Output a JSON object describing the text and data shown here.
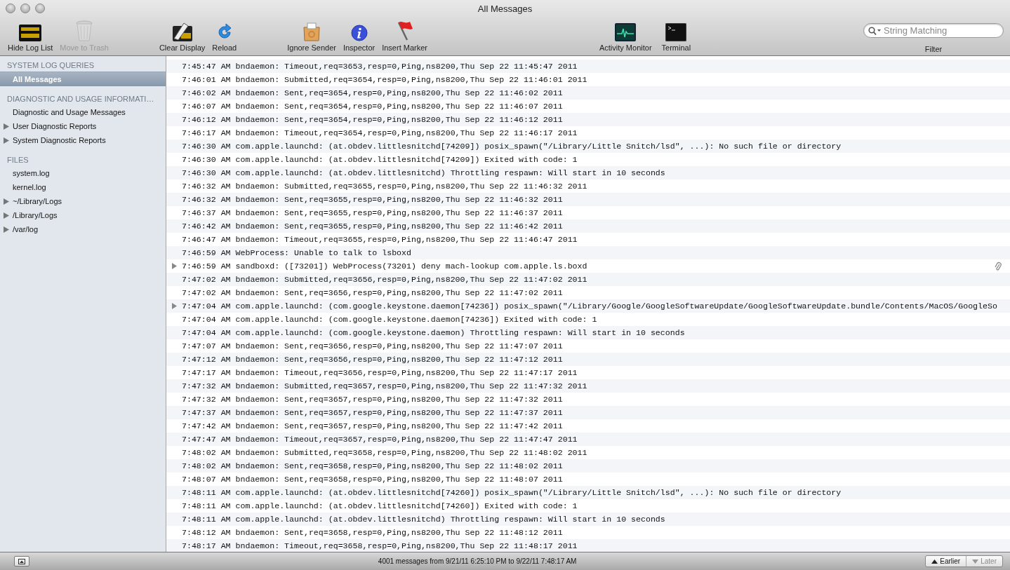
{
  "window": {
    "title": "All Messages"
  },
  "toolbar": {
    "left": [
      {
        "label": "Hide Log List",
        "disabled": false
      },
      {
        "label": "Move to Trash",
        "disabled": true
      },
      {
        "label": "Clear Display",
        "disabled": false
      },
      {
        "label": "Reload",
        "disabled": false
      },
      {
        "label": "Ignore Sender",
        "disabled": false
      },
      {
        "label": "Inspector",
        "disabled": false
      },
      {
        "label": "Insert Marker",
        "disabled": false
      }
    ],
    "right": [
      {
        "label": "Activity Monitor",
        "disabled": false
      },
      {
        "label": "Terminal",
        "disabled": false
      }
    ],
    "search": {
      "placeholder": "String Matching",
      "label": "Filter"
    }
  },
  "sidebar": [
    {
      "heading": "SYSTEM LOG QUERIES",
      "items": [
        {
          "label": "All Messages",
          "kind": "item",
          "selected": true
        }
      ]
    },
    {
      "heading": "DIAGNOSTIC AND USAGE INFORMATI…",
      "items": [
        {
          "label": "Diagnostic and Usage Messages",
          "kind": "item",
          "selected": false
        },
        {
          "label": "User Diagnostic Reports",
          "kind": "group",
          "selected": false
        },
        {
          "label": "System Diagnostic Reports",
          "kind": "group",
          "selected": false
        }
      ]
    },
    {
      "heading": "FILES",
      "items": [
        {
          "label": "system.log",
          "kind": "item",
          "selected": false
        },
        {
          "label": "kernel.log",
          "kind": "item",
          "selected": false
        },
        {
          "label": "~/Library/Logs",
          "kind": "group",
          "selected": false
        },
        {
          "label": "/Library/Logs",
          "kind": "group",
          "selected": false
        },
        {
          "label": "/var/log",
          "kind": "group",
          "selected": false
        }
      ]
    }
  ],
  "log": [
    {
      "text": "7:45:47 AM bndaemon: Timeout,req=3653,resp=0,Ping,ns8200,Thu Sep 22 11:45:47 2011",
      "kind": "plain",
      "attachment": false
    },
    {
      "text": "7:46:01 AM bndaemon: Submitted,req=3654,resp=0,Ping,ns8200,Thu Sep 22 11:46:01 2011",
      "kind": "plain",
      "attachment": false
    },
    {
      "text": "7:46:02 AM bndaemon: Sent,req=3654,resp=0,Ping,ns8200,Thu Sep 22 11:46:02 2011",
      "kind": "plain",
      "attachment": false
    },
    {
      "text": "7:46:07 AM bndaemon: Sent,req=3654,resp=0,Ping,ns8200,Thu Sep 22 11:46:07 2011",
      "kind": "plain",
      "attachment": false
    },
    {
      "text": "7:46:12 AM bndaemon: Sent,req=3654,resp=0,Ping,ns8200,Thu Sep 22 11:46:12 2011",
      "kind": "plain",
      "attachment": false
    },
    {
      "text": "7:46:17 AM bndaemon: Timeout,req=3654,resp=0,Ping,ns8200,Thu Sep 22 11:46:17 2011",
      "kind": "plain",
      "attachment": false
    },
    {
      "text": "7:46:30 AM com.apple.launchd: (at.obdev.littlesnitchd[74209]) posix_spawn(\"/Library/Little Snitch/lsd\", ...): No such file or directory",
      "kind": "plain",
      "attachment": false
    },
    {
      "text": "7:46:30 AM com.apple.launchd: (at.obdev.littlesnitchd[74209]) Exited with code: 1",
      "kind": "plain",
      "attachment": false
    },
    {
      "text": "7:46:30 AM com.apple.launchd: (at.obdev.littlesnitchd) Throttling respawn: Will start in 10 seconds",
      "kind": "plain",
      "attachment": false
    },
    {
      "text": "7:46:32 AM bndaemon: Submitted,req=3655,resp=0,Ping,ns8200,Thu Sep 22 11:46:32 2011",
      "kind": "plain",
      "attachment": false
    },
    {
      "text": "7:46:32 AM bndaemon: Sent,req=3655,resp=0,Ping,ns8200,Thu Sep 22 11:46:32 2011",
      "kind": "plain",
      "attachment": false
    },
    {
      "text": "7:46:37 AM bndaemon: Sent,req=3655,resp=0,Ping,ns8200,Thu Sep 22 11:46:37 2011",
      "kind": "plain",
      "attachment": false
    },
    {
      "text": "7:46:42 AM bndaemon: Sent,req=3655,resp=0,Ping,ns8200,Thu Sep 22 11:46:42 2011",
      "kind": "plain",
      "attachment": false
    },
    {
      "text": "7:46:47 AM bndaemon: Timeout,req=3655,resp=0,Ping,ns8200,Thu Sep 22 11:46:47 2011",
      "kind": "plain",
      "attachment": false
    },
    {
      "text": "7:46:59 AM WebProcess: Unable to talk to lsboxd",
      "kind": "plain",
      "attachment": false
    },
    {
      "text": "7:46:59 AM sandboxd: ([73201]) WebProcess(73201) deny mach-lookup com.apple.ls.boxd",
      "kind": "expandable",
      "attachment": true
    },
    {
      "text": "7:47:02 AM bndaemon: Submitted,req=3656,resp=0,Ping,ns8200,Thu Sep 22 11:47:02 2011",
      "kind": "plain",
      "attachment": false
    },
    {
      "text": "7:47:02 AM bndaemon: Sent,req=3656,resp=0,Ping,ns8200,Thu Sep 22 11:47:02 2011",
      "kind": "plain",
      "attachment": false
    },
    {
      "text": "7:47:04 AM com.apple.launchd: (com.google.keystone.daemon[74236]) posix_spawn(\"/Library/Google/GoogleSoftwareUpdate/GoogleSoftwareUpdate.bundle/Contents/MacOS/GoogleSo",
      "kind": "expandable",
      "attachment": false
    },
    {
      "text": "7:47:04 AM com.apple.launchd: (com.google.keystone.daemon[74236]) Exited with code: 1",
      "kind": "plain",
      "attachment": false
    },
    {
      "text": "7:47:04 AM com.apple.launchd: (com.google.keystone.daemon) Throttling respawn: Will start in 10 seconds",
      "kind": "plain",
      "attachment": false
    },
    {
      "text": "7:47:07 AM bndaemon: Sent,req=3656,resp=0,Ping,ns8200,Thu Sep 22 11:47:07 2011",
      "kind": "plain",
      "attachment": false
    },
    {
      "text": "7:47:12 AM bndaemon: Sent,req=3656,resp=0,Ping,ns8200,Thu Sep 22 11:47:12 2011",
      "kind": "plain",
      "attachment": false
    },
    {
      "text": "7:47:17 AM bndaemon: Timeout,req=3656,resp=0,Ping,ns8200,Thu Sep 22 11:47:17 2011",
      "kind": "plain",
      "attachment": false
    },
    {
      "text": "7:47:32 AM bndaemon: Submitted,req=3657,resp=0,Ping,ns8200,Thu Sep 22 11:47:32 2011",
      "kind": "plain",
      "attachment": false
    },
    {
      "text": "7:47:32 AM bndaemon: Sent,req=3657,resp=0,Ping,ns8200,Thu Sep 22 11:47:32 2011",
      "kind": "plain",
      "attachment": false
    },
    {
      "text": "7:47:37 AM bndaemon: Sent,req=3657,resp=0,Ping,ns8200,Thu Sep 22 11:47:37 2011",
      "kind": "plain",
      "attachment": false
    },
    {
      "text": "7:47:42 AM bndaemon: Sent,req=3657,resp=0,Ping,ns8200,Thu Sep 22 11:47:42 2011",
      "kind": "plain",
      "attachment": false
    },
    {
      "text": "7:47:47 AM bndaemon: Timeout,req=3657,resp=0,Ping,ns8200,Thu Sep 22 11:47:47 2011",
      "kind": "plain",
      "attachment": false
    },
    {
      "text": "7:48:02 AM bndaemon: Submitted,req=3658,resp=0,Ping,ns8200,Thu Sep 22 11:48:02 2011",
      "kind": "plain",
      "attachment": false
    },
    {
      "text": "7:48:02 AM bndaemon: Sent,req=3658,resp=0,Ping,ns8200,Thu Sep 22 11:48:02 2011",
      "kind": "plain",
      "attachment": false
    },
    {
      "text": "7:48:07 AM bndaemon: Sent,req=3658,resp=0,Ping,ns8200,Thu Sep 22 11:48:07 2011",
      "kind": "plain",
      "attachment": false
    },
    {
      "text": "7:48:11 AM com.apple.launchd: (at.obdev.littlesnitchd[74260]) posix_spawn(\"/Library/Little Snitch/lsd\", ...): No such file or directory",
      "kind": "plain",
      "attachment": false
    },
    {
      "text": "7:48:11 AM com.apple.launchd: (at.obdev.littlesnitchd[74260]) Exited with code: 1",
      "kind": "plain",
      "attachment": false
    },
    {
      "text": "7:48:11 AM com.apple.launchd: (at.obdev.littlesnitchd) Throttling respawn: Will start in 10 seconds",
      "kind": "plain",
      "attachment": false
    },
    {
      "text": "7:48:12 AM bndaemon: Sent,req=3658,resp=0,Ping,ns8200,Thu Sep 22 11:48:12 2011",
      "kind": "plain",
      "attachment": false
    },
    {
      "text": "7:48:17 AM bndaemon: Timeout,req=3658,resp=0,Ping,ns8200,Thu Sep 22 11:48:17 2011",
      "kind": "plain",
      "attachment": false
    }
  ],
  "status_bar": {
    "text": "4001 messages from 9/21/11 6:25:10 PM to 9/22/11 7:48:17 AM",
    "earlier": "Earlier",
    "later": "Later"
  }
}
